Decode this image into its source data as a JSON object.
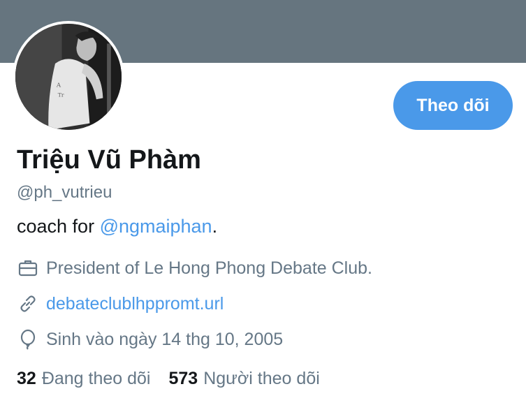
{
  "profile": {
    "name": "Triệu Vũ Phàm",
    "handle": "@ph_vutrieu",
    "bio_prefix": "coach for ",
    "bio_mention": "@ngmaiphan",
    "bio_suffix": ".",
    "job": "President of Le Hong Phong Debate Club.",
    "url": "debateclublhppromt.url",
    "birthday": "Sinh vào ngày 14 thg 10, 2005"
  },
  "actions": {
    "follow_label": "Theo dõi"
  },
  "stats": {
    "following_count": "32",
    "following_label": "Đang theo dõi",
    "followers_count": "573",
    "followers_label": "Người theo dõi"
  },
  "icons": {
    "job": "briefcase-icon",
    "url": "link-icon",
    "birthday": "balloon-icon"
  },
  "colors": {
    "banner": "#66757f",
    "accent": "#4a99e9",
    "secondary_text": "#657786",
    "primary_text": "#14171a"
  }
}
